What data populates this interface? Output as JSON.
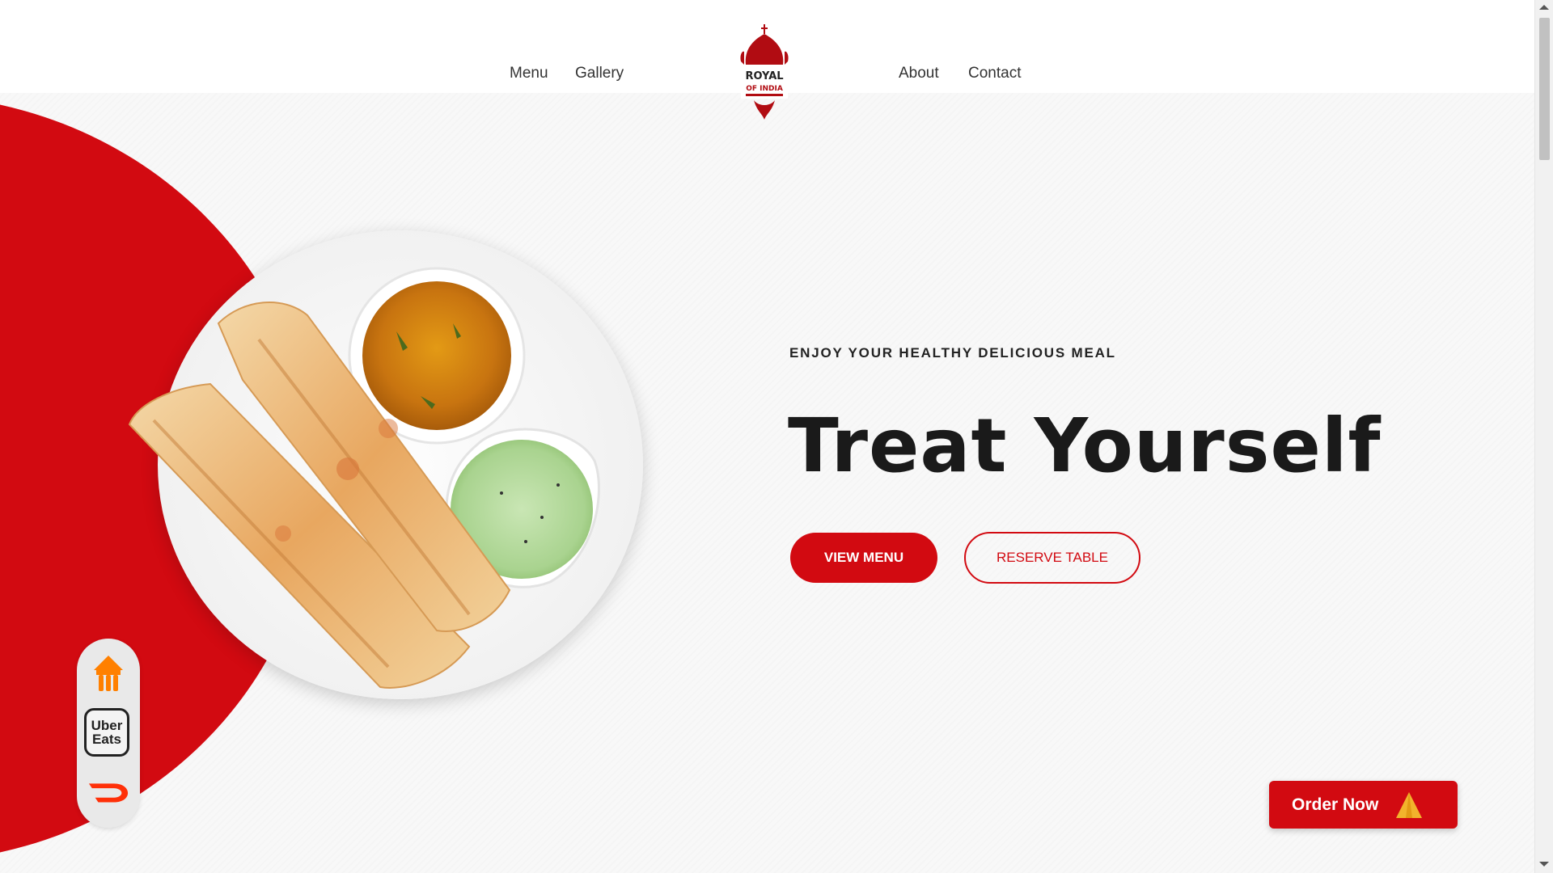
{
  "nav": {
    "left": [
      "Menu",
      "Gallery"
    ],
    "right": [
      "About",
      "Contact"
    ]
  },
  "logo": {
    "line1": "ROYAL",
    "line2": "OF INDIA"
  },
  "hero": {
    "eyebrow": "ENJOY YOUR HEALTHY DELICIOUS MEAL",
    "title": "Treat Yourself",
    "primary_button": "VIEW MENU",
    "secondary_button": "RESERVE TABLE"
  },
  "delivery": {
    "uber_line1": "Uber",
    "uber_line2": "Eats",
    "icons": [
      "just-eat-icon",
      "uber-eats-icon",
      "doordash-icon"
    ]
  },
  "order": {
    "label": "Order Now",
    "icon": "samosa-icon"
  },
  "colors": {
    "brand_red": "#d20a11",
    "background": "#f8f8f8",
    "orange": "#ff8000"
  }
}
